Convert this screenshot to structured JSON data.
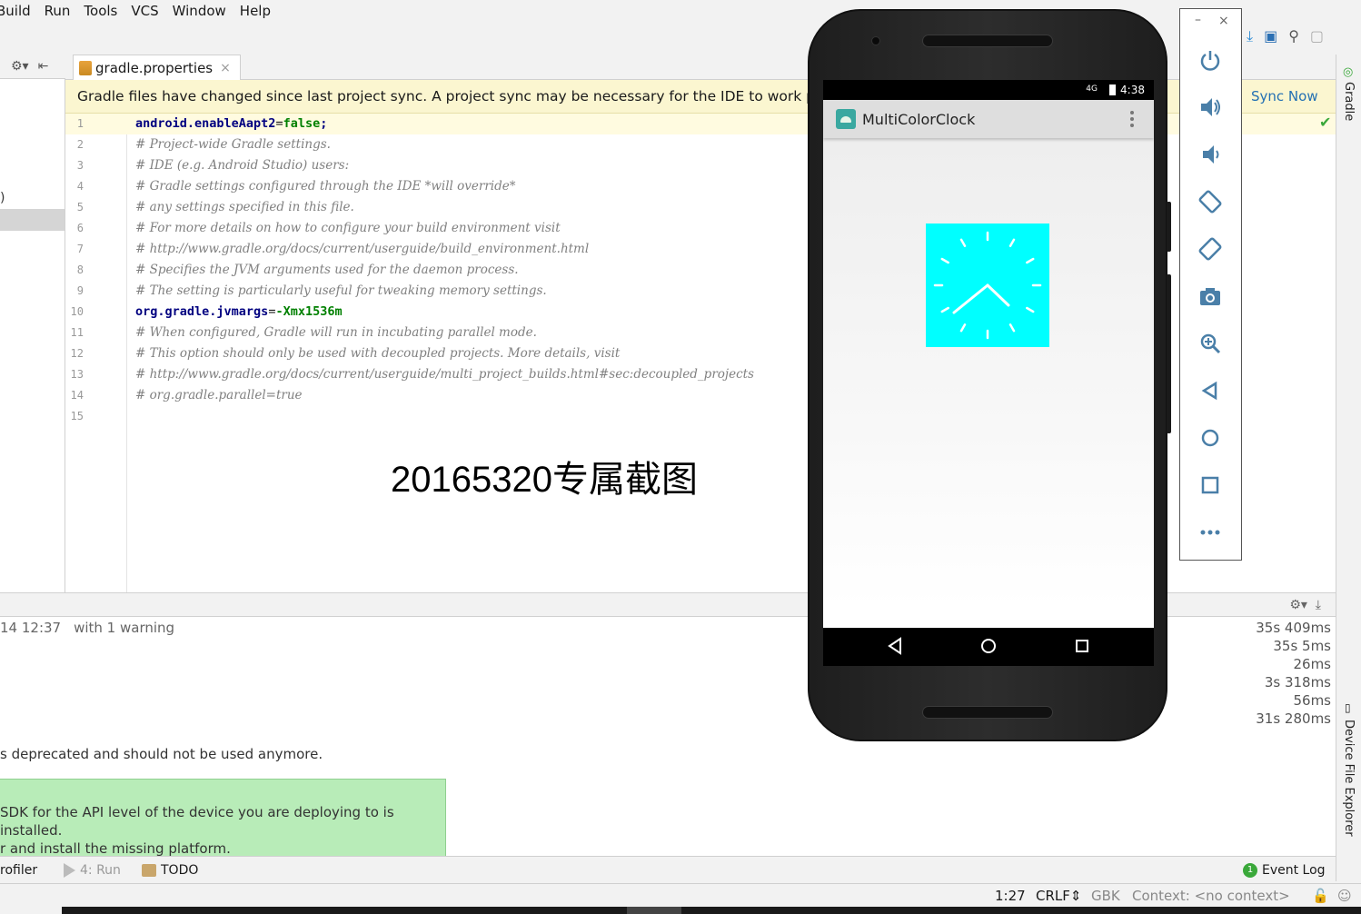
{
  "menu": [
    "Build",
    "Run",
    "Tools",
    "VCS",
    "Window",
    "Help"
  ],
  "left_panel": {
    "paren": ")"
  },
  "editor_tab": {
    "label": "gradle.properties",
    "close": "×"
  },
  "notification": {
    "message": "Gradle files have changed since last project sync. A project sync may be necessary for the IDE to work properly.",
    "action": "Sync Now"
  },
  "code_lines": [
    {
      "n": "1"
    },
    {
      "n": "2",
      "text": "# Project-wide Gradle settings."
    },
    {
      "n": "3",
      "text": "# IDE (e.g. Android Studio) users:"
    },
    {
      "n": "4",
      "text": "# Gradle settings configured through the IDE *will override*"
    },
    {
      "n": "5",
      "text": "# any settings specified in this file."
    },
    {
      "n": "6",
      "text": "# For more details on how to configure your build environment visit"
    },
    {
      "n": "7",
      "text": "# http://www.gradle.org/docs/current/userguide/build_environment.html"
    },
    {
      "n": "8",
      "text": "# Specifies the JVM arguments used for the daemon process."
    },
    {
      "n": "9",
      "text": "# The setting is particularly useful for tweaking memory settings."
    },
    {
      "n": "10"
    },
    {
      "n": "11",
      "text": "# When configured, Gradle will run in incubating parallel mode."
    },
    {
      "n": "12",
      "text": "# This option should only be used with decoupled projects. More details, visit"
    },
    {
      "n": "13",
      "text": "# http://www.gradle.org/docs/current/userguide/multi_project_builds.html#sec:decoupled_projects"
    },
    {
      "n": "14",
      "text": "# org.gradle.parallel=true"
    },
    {
      "n": "15"
    }
  ],
  "line1": {
    "key": "android.enableAapt2",
    "eq": "=",
    "val": "false",
    "semi": ";"
  },
  "line10": {
    "key": "org.gradle.jvmargs",
    "eq": "=",
    "val": "-Xmx1536m"
  },
  "watermark": "20165320专属截图",
  "right_strip": {
    "gradle": "Gradle",
    "device_explorer": "Device File Explorer"
  },
  "build_output": {
    "timestamp": "14 12:37",
    "warning": "with 1 warning",
    "deprecated": "s deprecated and should not be used anymore.",
    "times": [
      "35s 409ms",
      "35s 5ms",
      "26ms",
      "3s 318ms",
      "56ms",
      "31s 280ms"
    ]
  },
  "balloon": {
    "line1": "SDK for the API level of the device you are deploying to is installed.",
    "line2": "r and install the missing platform."
  },
  "tool_windows": {
    "profiler": "rofiler",
    "run": "4: Run",
    "todo": "TODO",
    "event_log_count": "1",
    "event_log": "Event Log"
  },
  "status_bar": {
    "position": "1:27",
    "line_sep": "CRLF",
    "encoding": "GBK",
    "context": "Context: <no context>"
  },
  "phone": {
    "time": "4:38",
    "network": "4G",
    "app_title": "MultiColorClock",
    "clock_color": "#00ffff"
  },
  "emulator": {
    "minimize": "–",
    "close": "×"
  }
}
